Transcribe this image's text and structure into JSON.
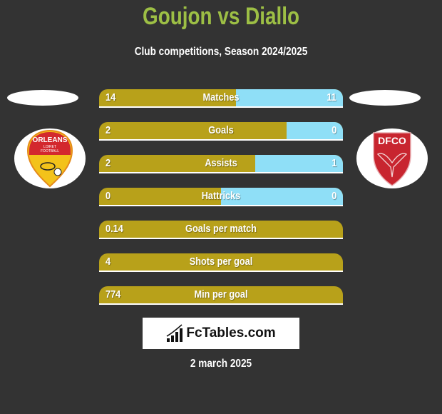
{
  "header": {
    "title": "Goujon vs Diallo",
    "subtitle": "Club competitions, Season 2024/2025"
  },
  "players": {
    "left": {
      "name": "Goujon",
      "club_badge": "orleans-loiret-football-badge",
      "badge_text": [
        "ORLEANS",
        "LOIRET",
        "FOOTBALL"
      ]
    },
    "right": {
      "name": "Diallo",
      "club_badge": "dfco-badge",
      "badge_text": [
        "DFCO"
      ]
    }
  },
  "colors": {
    "left_bar": "#b8a11a",
    "right_bar": "#8fdff7",
    "title": "#9dbf45",
    "background": "#333333"
  },
  "stats": [
    {
      "label": "Matches",
      "left": "14",
      "right": "11",
      "left_share": 0.56
    },
    {
      "label": "Goals",
      "left": "2",
      "right": "0",
      "left_share": 0.77
    },
    {
      "label": "Assists",
      "left": "2",
      "right": "1",
      "left_share": 0.64
    },
    {
      "label": "Hattricks",
      "left": "0",
      "right": "0",
      "left_share": 0.5
    },
    {
      "label": "Goals per match",
      "left": "0.14",
      "right": "",
      "left_share": 1.0
    },
    {
      "label": "Shots per goal",
      "left": "4",
      "right": "",
      "left_share": 1.0
    },
    {
      "label": "Min per goal",
      "left": "774",
      "right": "",
      "left_share": 1.0
    }
  ],
  "footer": {
    "brand": "FcTables.com",
    "brand_icon": "bar-chart-icon",
    "date": "2 march 2025"
  }
}
